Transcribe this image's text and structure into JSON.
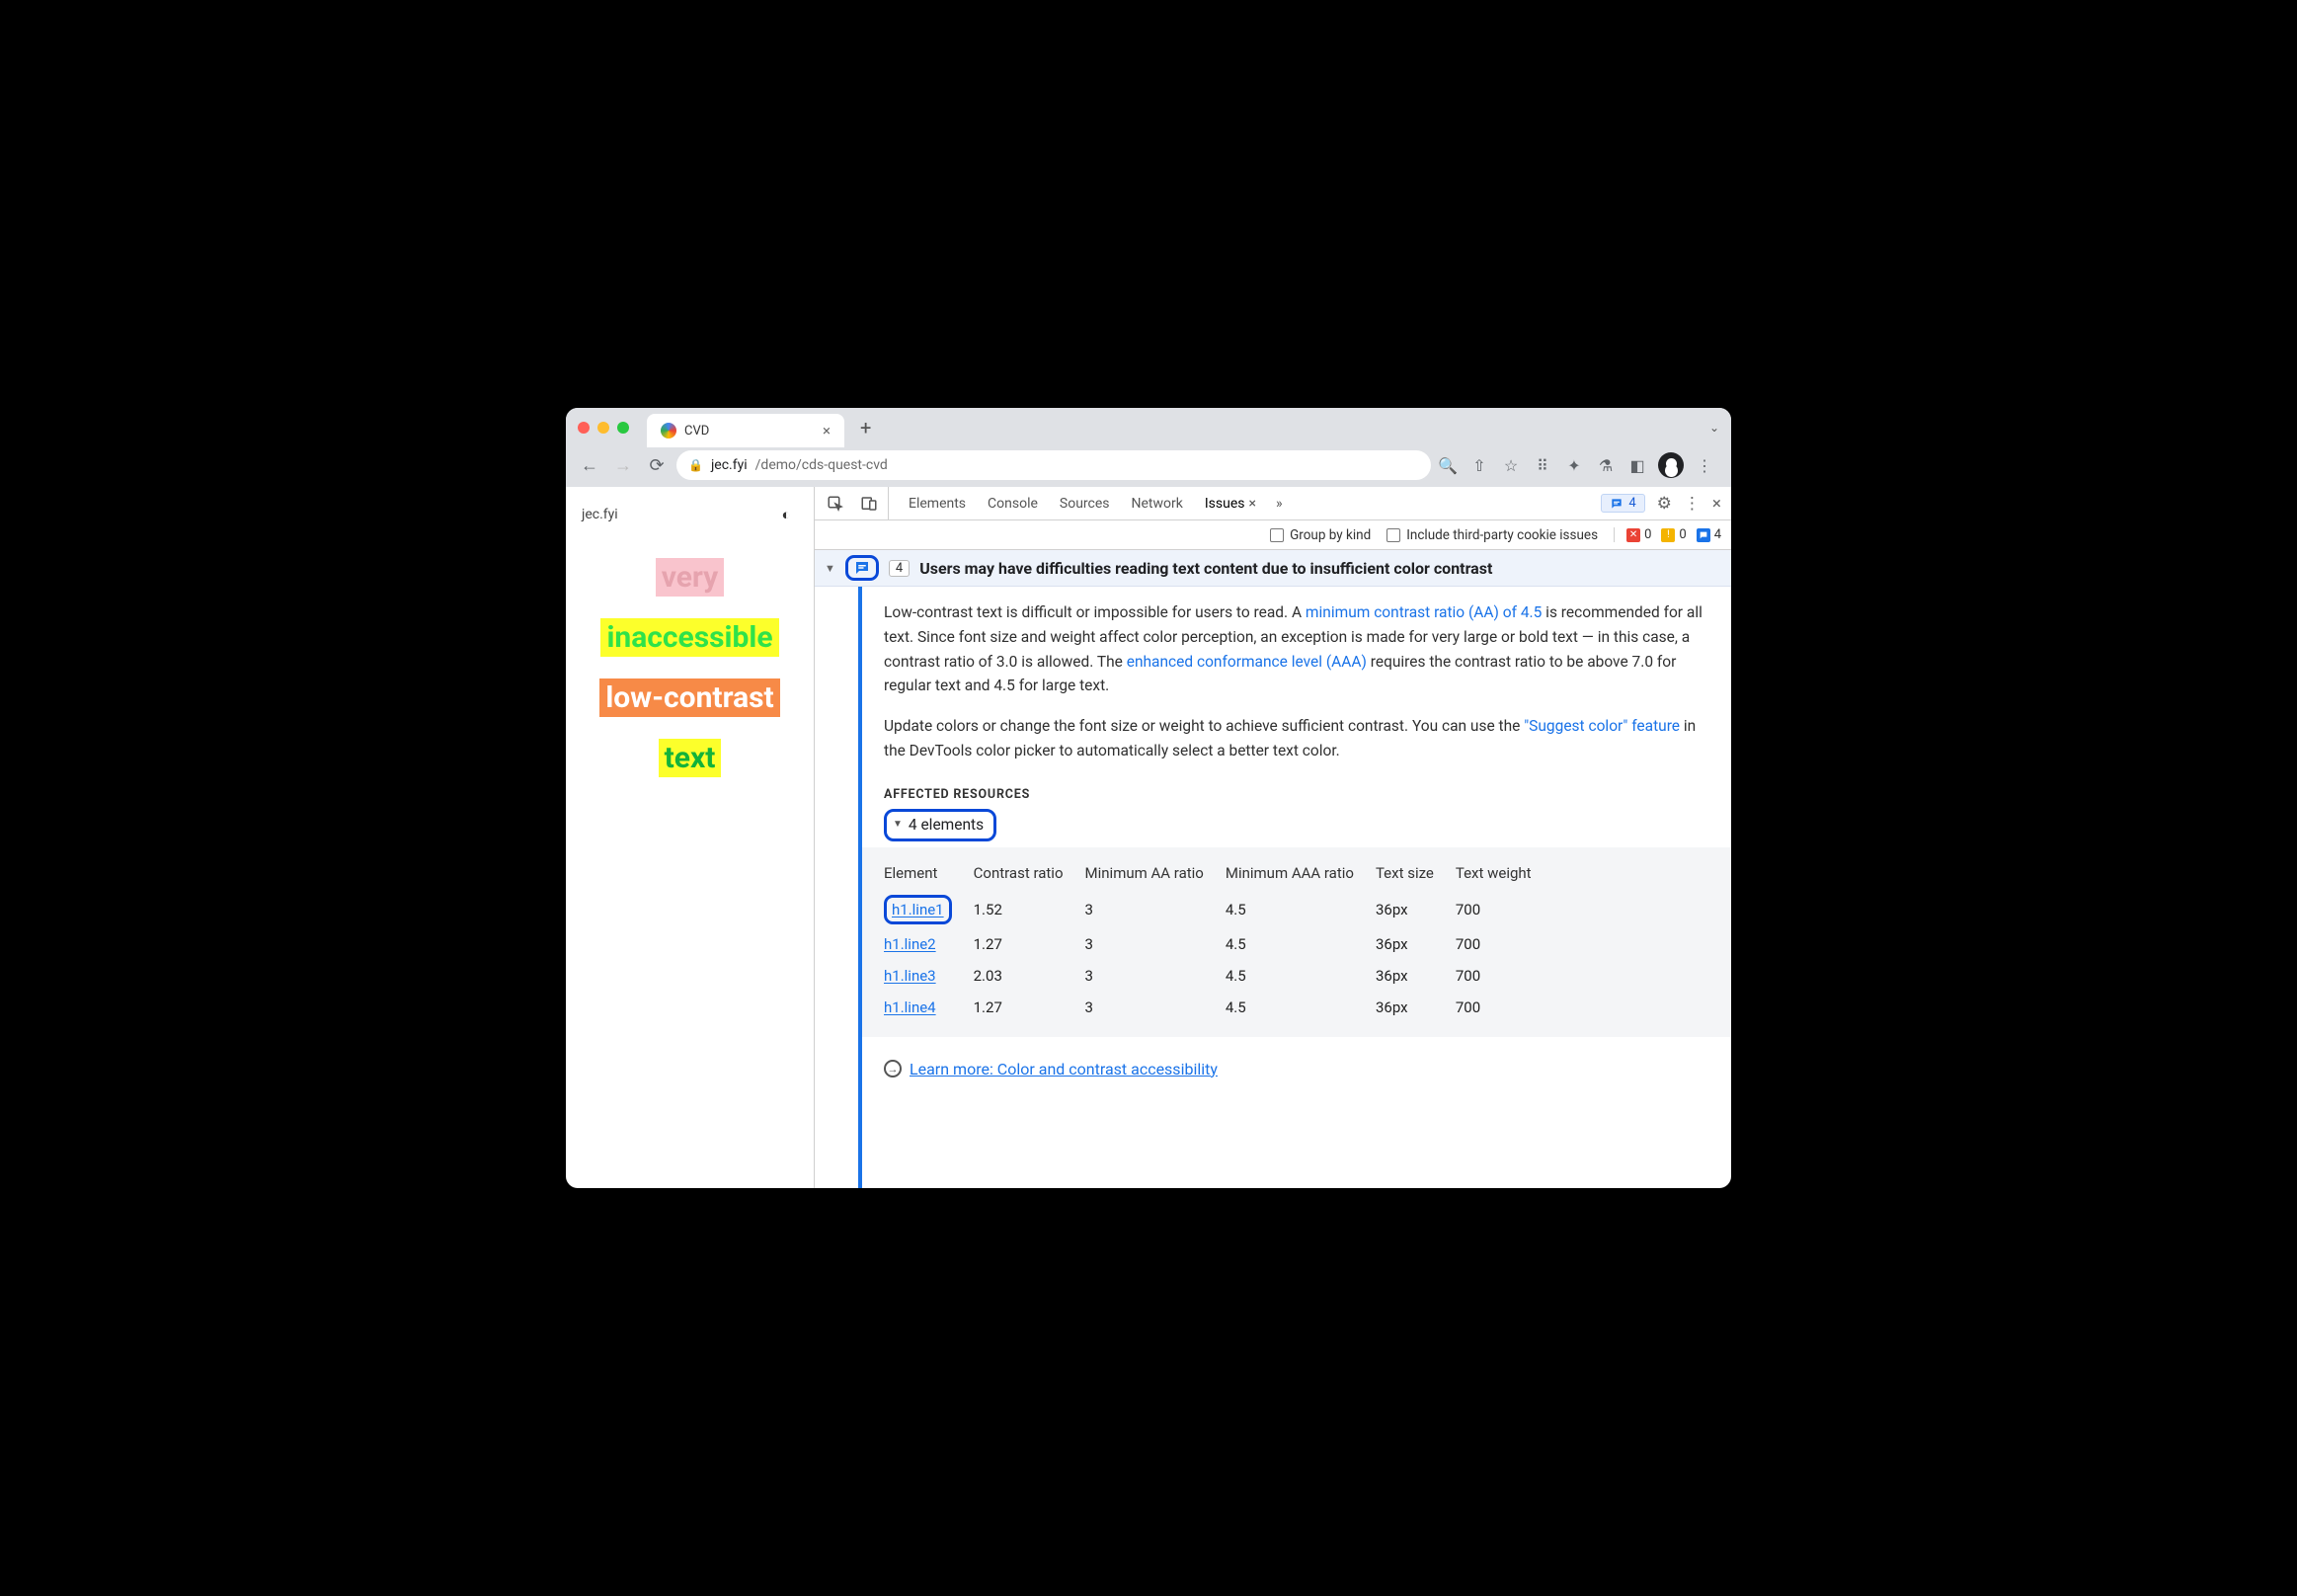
{
  "browser": {
    "tab_title": "CVD",
    "url_host": "jec.fyi",
    "url_path": "/demo/cds-quest-cvd"
  },
  "page": {
    "site_label": "jec.fyi",
    "samples": [
      "very",
      "inaccessible",
      "low-contrast",
      "text"
    ]
  },
  "devtools": {
    "tabs": [
      "Elements",
      "Console",
      "Sources",
      "Network",
      "Issues"
    ],
    "active_tab": "Issues",
    "issues_badge_count": "4",
    "filter": {
      "group_by_kind": "Group by kind",
      "third_party": "Include third-party cookie issues"
    },
    "counters": {
      "errors": "0",
      "warnings": "0",
      "info": "4"
    },
    "issue": {
      "count": "4",
      "title": "Users may have difficulties reading text content due to insufficient color contrast",
      "p1_a": "Low-contrast text is difficult or impossible for users to read. A ",
      "p1_link1": "minimum contrast ratio (AA) of 4.5",
      "p1_b": " is recommended for all text. Since font size and weight affect color perception, an exception is made for very large or bold text — in this case, a contrast ratio of 3.0 is allowed. The ",
      "p1_link2": "enhanced conformance level (AAA)",
      "p1_c": " requires the contrast ratio to be above 7.0 for regular text and 4.5 for large text.",
      "p2_a": "Update colors or change the font size or weight to achieve sufficient contrast. You can use the ",
      "p2_link": "\"Suggest color\" feature",
      "p2_b": " in the DevTools color picker to automatically select a better text color.",
      "affected_label": "AFFECTED RESOURCES",
      "affected_count": "4 elements",
      "columns": [
        "Element",
        "Contrast ratio",
        "Minimum AA ratio",
        "Minimum AAA ratio",
        "Text size",
        "Text weight"
      ],
      "rows": [
        {
          "el": "h1.line1",
          "cr": "1.52",
          "aa": "3",
          "aaa": "4.5",
          "size": "36px",
          "weight": "700"
        },
        {
          "el": "h1.line2",
          "cr": "1.27",
          "aa": "3",
          "aaa": "4.5",
          "size": "36px",
          "weight": "700"
        },
        {
          "el": "h1.line3",
          "cr": "2.03",
          "aa": "3",
          "aaa": "4.5",
          "size": "36px",
          "weight": "700"
        },
        {
          "el": "h1.line4",
          "cr": "1.27",
          "aa": "3",
          "aaa": "4.5",
          "size": "36px",
          "weight": "700"
        }
      ],
      "learn_more": "Learn more: Color and contrast accessibility"
    }
  }
}
